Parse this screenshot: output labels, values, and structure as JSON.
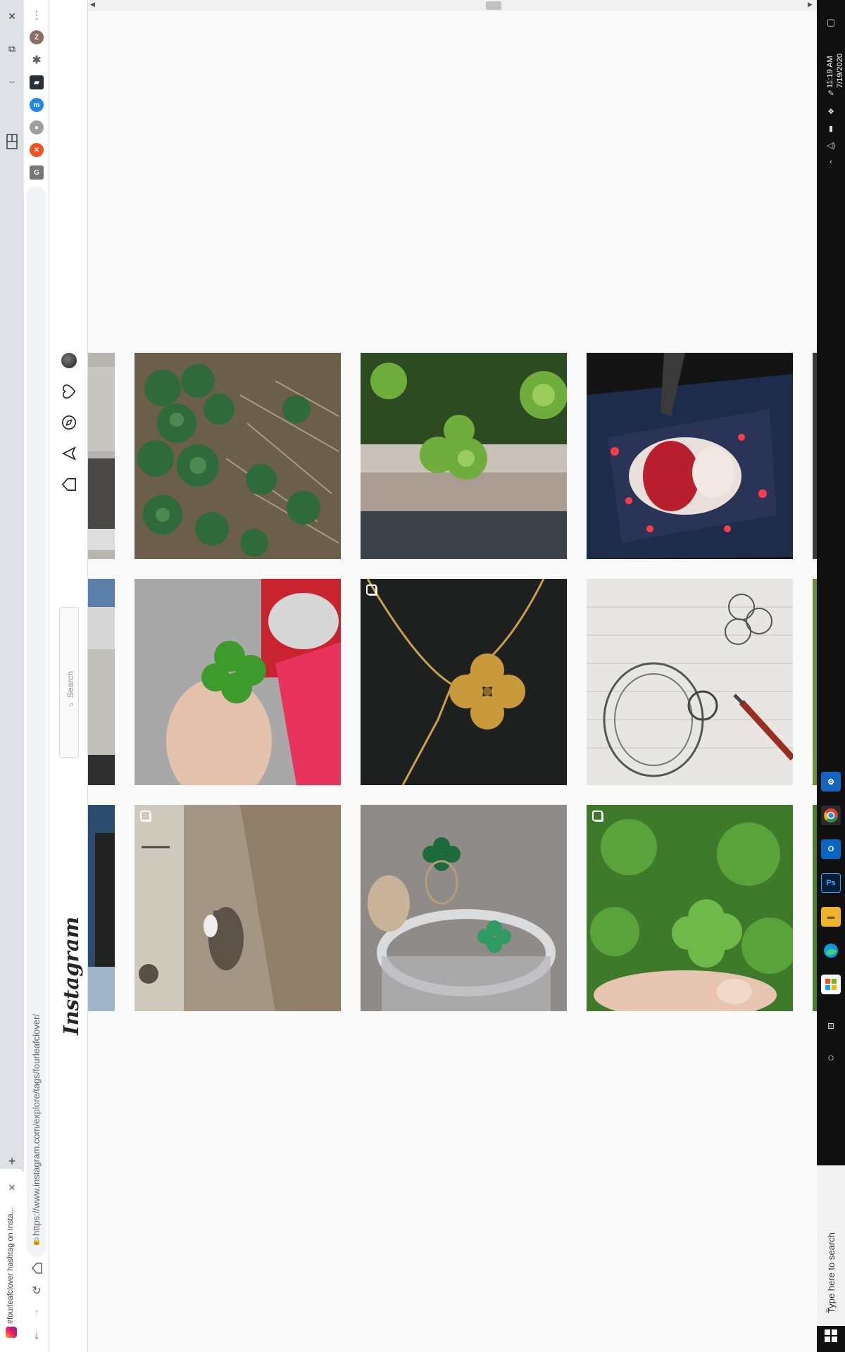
{
  "browser": {
    "tab": {
      "title": "#fourleafclover hashtag on Insta...",
      "favicon": "instagram-icon"
    },
    "url": "https://www.instagram.com/explore/tags/fourleafclover/",
    "new_tab_label": "+",
    "profile_initial": "Z"
  },
  "instagram": {
    "logo": "Instagram",
    "search_placeholder": "Search",
    "nav_icons": [
      "home-icon",
      "direct-icon",
      "explore-icon",
      "activity-icon",
      "profile-avatar"
    ]
  },
  "posts": [
    {
      "id": "p1",
      "subject": "clover-patch",
      "multi": false
    },
    {
      "id": "p2",
      "subject": "clover-in-planter",
      "multi": false
    },
    {
      "id": "p3",
      "subject": "anime-drawing-tablet",
      "multi": false
    },
    {
      "id": "p4",
      "subject": "clover-in-hand",
      "multi": false
    },
    {
      "id": "p5",
      "subject": "gold-clover-necklace",
      "multi": true
    },
    {
      "id": "p6",
      "subject": "watch-sketch",
      "multi": false
    },
    {
      "id": "p7",
      "subject": "horse-rider-field",
      "multi": true
    },
    {
      "id": "p8",
      "subject": "green-clover-earrings",
      "multi": false
    },
    {
      "id": "p9",
      "subject": "clover-held-greenery",
      "multi": true
    }
  ],
  "taskbar": {
    "time": "11:19 AM",
    "date": "7/19/2020",
    "search_placeholder": "Type here to search"
  },
  "colors": {
    "ig_border": "#dbdbdb",
    "page_bg": "#fafafa",
    "taskbar": "#101010"
  }
}
